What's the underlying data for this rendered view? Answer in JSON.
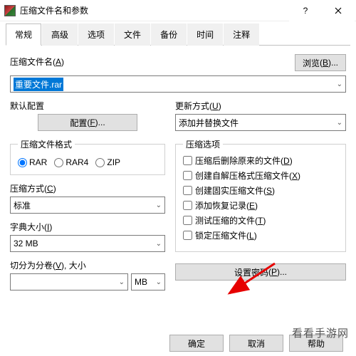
{
  "window": {
    "title": "压缩文件名和参数"
  },
  "tabs": [
    "常规",
    "高级",
    "选项",
    "文件",
    "备份",
    "时间",
    "注释"
  ],
  "archive": {
    "nameLabel": "压缩文件名",
    "nameKey": "A",
    "browse": "浏览",
    "browseKey": "B",
    "filename": "重要文件.rar"
  },
  "profile": {
    "label": "默认配置",
    "button": "配置",
    "key": "F"
  },
  "format": {
    "label": "压缩文件格式",
    "options": [
      "RAR",
      "RAR4",
      "ZIP"
    ],
    "selected": "RAR"
  },
  "method": {
    "label": "压缩方式",
    "key": "C",
    "value": "标准"
  },
  "dict": {
    "label": "字典大小",
    "key": "I",
    "value": "32 MB"
  },
  "split": {
    "label": "切分为分卷",
    "key": "V",
    "sizeLabel": "大小",
    "value": "",
    "unit": "MB"
  },
  "update": {
    "label": "更新方式",
    "key": "U",
    "value": "添加并替换文件"
  },
  "opts": {
    "label": "压缩选项",
    "items": [
      {
        "t": "压缩后删除原来的文件",
        "k": "D"
      },
      {
        "t": "创建自解压格式压缩文件",
        "k": "X"
      },
      {
        "t": "创建固实压缩文件",
        "k": "S"
      },
      {
        "t": "添加恢复记录",
        "k": "E"
      },
      {
        "t": "测试压缩的文件",
        "k": "T"
      },
      {
        "t": "锁定压缩文件",
        "k": "L"
      }
    ]
  },
  "password": {
    "label": "设置密码",
    "key": "P"
  },
  "buttons": {
    "ok": "确定",
    "cancel": "取消",
    "help": "帮助"
  },
  "watermark": "看看手游网"
}
